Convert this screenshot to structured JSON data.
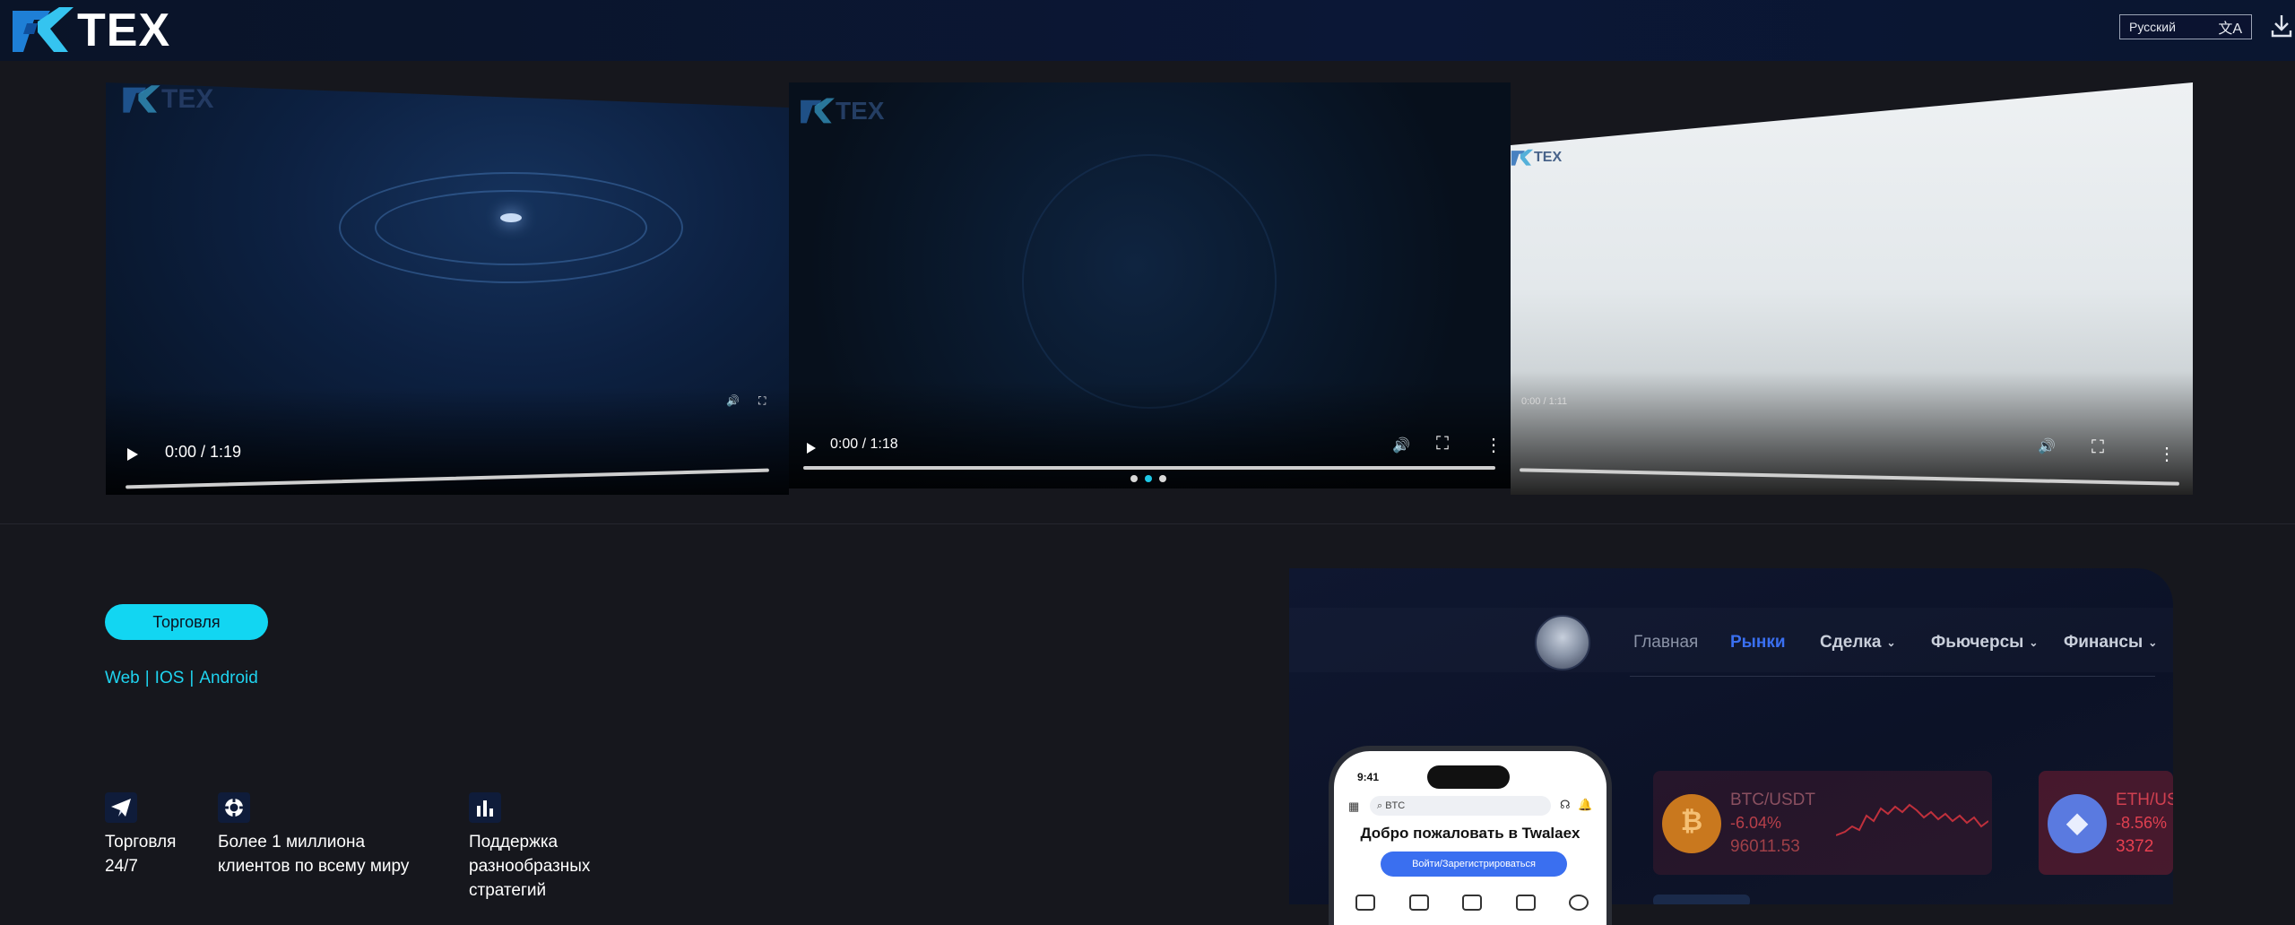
{
  "header": {
    "logo_text": "TEX",
    "language": "Русский",
    "translate_glyph": "文A"
  },
  "carousel": {
    "slides": [
      {
        "time": "0:00 / 1:19",
        "watermark": "TEX"
      },
      {
        "time": "0:00 / 1:18",
        "watermark": "TEX"
      },
      {
        "time": "0:00 / 1:11",
        "watermark": "TEX"
      }
    ],
    "active_dot": 1
  },
  "main": {
    "trade_button": "Торговля",
    "platforms": [
      "Web",
      "IOS",
      "Android"
    ],
    "separator": "|",
    "features": [
      {
        "icon": "paper-plane-icon",
        "line1": "Торговля",
        "line2": "24/7",
        "line3": ""
      },
      {
        "icon": "lifebuoy-icon",
        "line1": "Более 1 миллиона",
        "line2": "клиентов по всему миру",
        "line3": ""
      },
      {
        "icon": "bar-chart-icon",
        "line1": "Поддержка",
        "line2": "разнообразных",
        "line3": "стратегий"
      }
    ]
  },
  "promo": {
    "nav": [
      "Главная",
      "Рынки",
      "Сделка",
      "Фьючерсы",
      "Финансы"
    ],
    "tickers": [
      {
        "pair": "BTC/USDT",
        "change": "-6.04%",
        "price": "96011.53"
      },
      {
        "pair": "ETH/US",
        "change": "-8.56%",
        "price": "3372"
      }
    ],
    "phone": {
      "time": "9:41",
      "search": "BTC",
      "welcome": "Добро пожаловать в Twalaex",
      "button": "Войти/Зарегистрироваться"
    }
  },
  "colors": {
    "accent": "#12d6f2",
    "header_bg": "#0a1630",
    "page_bg": "#16171d",
    "nav_active": "#3a6ff0"
  }
}
